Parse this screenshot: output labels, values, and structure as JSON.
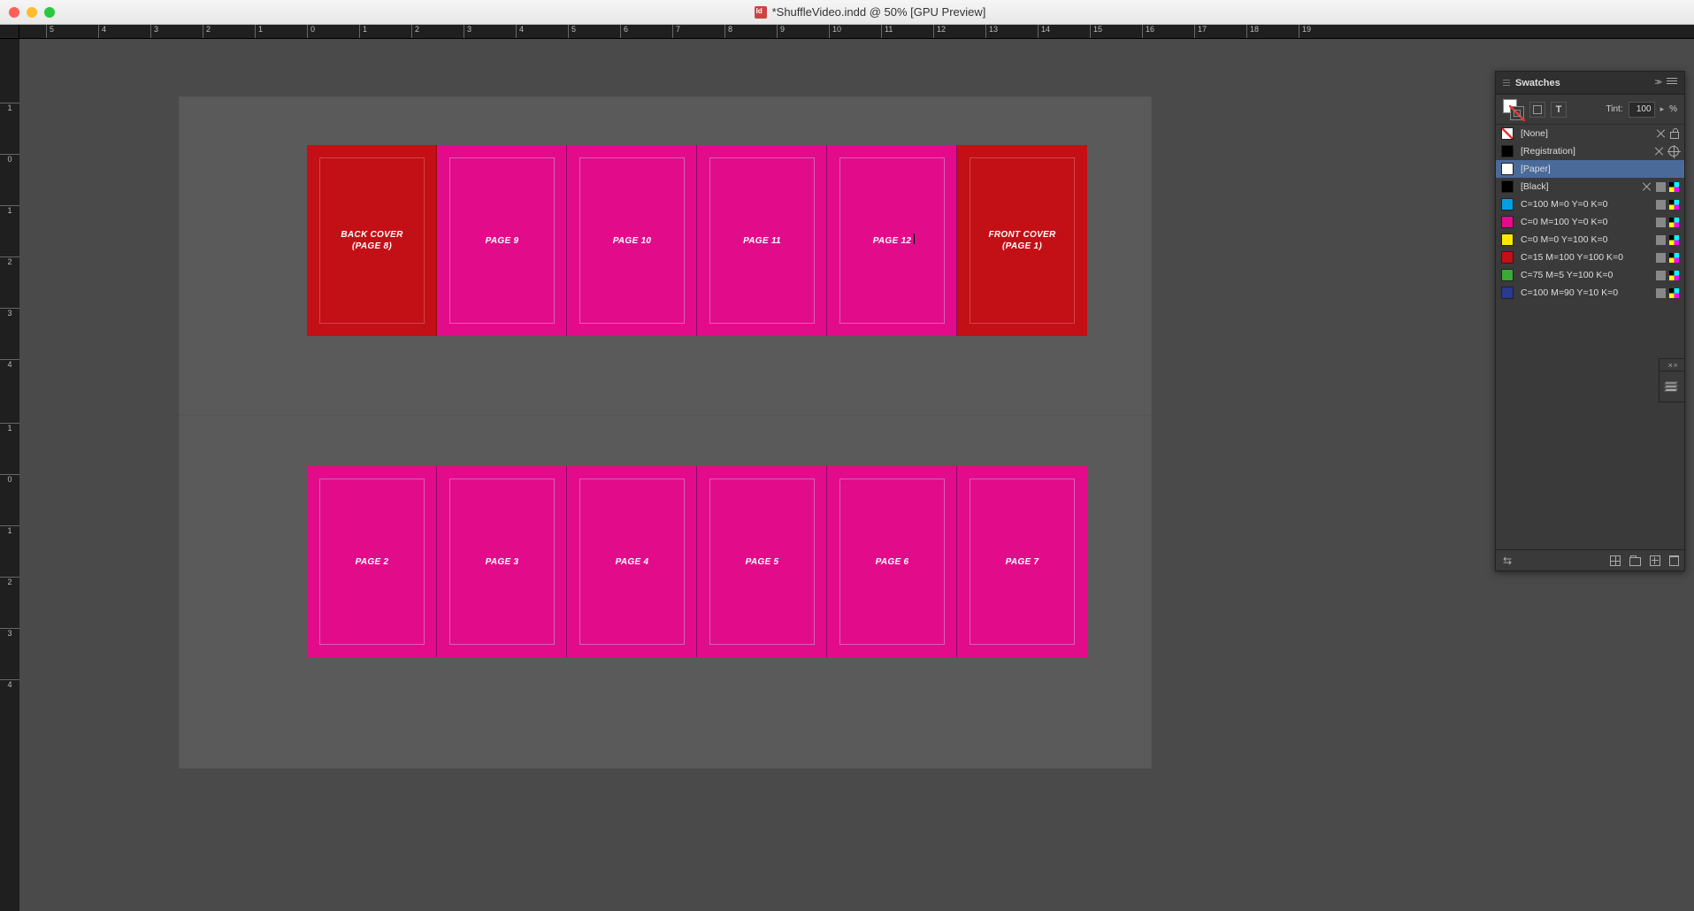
{
  "window": {
    "title": "*ShuffleVideo.indd @ 50% [GPU Preview]"
  },
  "ruler": {
    "h_labels": [
      "5",
      "4",
      "3",
      "2",
      "1",
      "0",
      "1",
      "2",
      "3",
      "4",
      "5",
      "6",
      "7",
      "8",
      "9",
      "10",
      "11",
      "12",
      "13",
      "14",
      "15",
      "16",
      "17",
      "18",
      "19"
    ],
    "v_row1": [
      "1",
      "0",
      "1",
      "2",
      "3",
      "4"
    ],
    "v_row2": [
      "1",
      "0",
      "1",
      "2",
      "3",
      "4"
    ]
  },
  "spreads": [
    {
      "pages": [
        {
          "label_line1": "BACK COVER",
          "label_line2": "(PAGE 8)",
          "color": "red"
        },
        {
          "label_line1": "PAGE 9",
          "color": "pink"
        },
        {
          "label_line1": "PAGE 10",
          "color": "pink"
        },
        {
          "label_line1": "PAGE 11",
          "color": "pink"
        },
        {
          "label_line1": "PAGE 12",
          "color": "pink",
          "cursor": true
        },
        {
          "label_line1": "FRONT COVER",
          "label_line2": "(PAGE 1)",
          "color": "red"
        }
      ]
    },
    {
      "pages": [
        {
          "label_line1": "PAGE 2",
          "color": "pink"
        },
        {
          "label_line1": "PAGE 3",
          "color": "pink"
        },
        {
          "label_line1": "PAGE 4",
          "color": "pink"
        },
        {
          "label_line1": "PAGE 5",
          "color": "pink"
        },
        {
          "label_line1": "PAGE 6",
          "color": "pink"
        },
        {
          "label_line1": "PAGE 7",
          "color": "pink"
        }
      ]
    }
  ],
  "swatches": {
    "title": "Swatches",
    "tint_label": "Tint:",
    "tint_value": "100",
    "tint_unit": "%",
    "items": [
      {
        "name": "[None]",
        "chip": "none",
        "icons": [
          "x",
          "lock"
        ]
      },
      {
        "name": "[Registration]",
        "chip": "#000000",
        "icons": [
          "x",
          "reg"
        ]
      },
      {
        "name": "[Paper]",
        "chip": "#ffffff",
        "icons": [],
        "selected": true
      },
      {
        "name": "[Black]",
        "chip": "#000000",
        "icons": [
          "x",
          "sq",
          "cmyk"
        ]
      },
      {
        "name": "C=100 M=0 Y=0 K=0",
        "chip": "#00a0e3",
        "icons": [
          "sq",
          "cmyk"
        ]
      },
      {
        "name": "C=0 M=100 Y=0 K=0",
        "chip": "#e20c8b",
        "icons": [
          "sq",
          "cmyk"
        ]
      },
      {
        "name": "C=0 M=0 Y=100 K=0",
        "chip": "#fde900",
        "icons": [
          "sq",
          "cmyk"
        ]
      },
      {
        "name": "C=15 M=100 Y=100 K=0",
        "chip": "#c30f16",
        "icons": [
          "sq",
          "cmyk"
        ]
      },
      {
        "name": "C=75 M=5 Y=100 K=0",
        "chip": "#3aa935",
        "icons": [
          "sq",
          "cmyk"
        ]
      },
      {
        "name": "C=100 M=90 Y=10 K=0",
        "chip": "#2a3a8f",
        "icons": [
          "sq",
          "cmyk"
        ]
      }
    ]
  }
}
